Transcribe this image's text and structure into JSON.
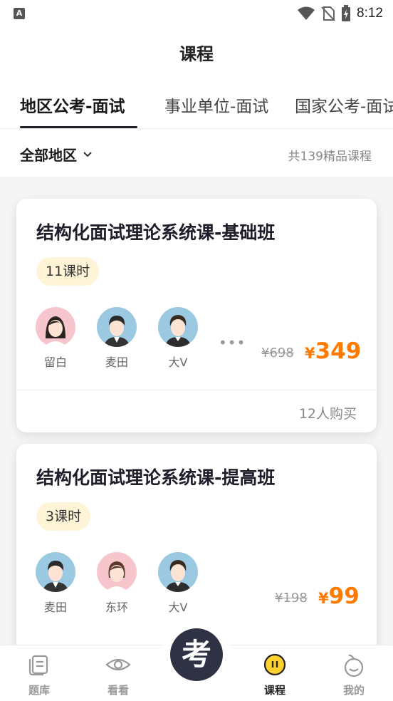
{
  "status": {
    "time": "8:12",
    "app_badge": "A"
  },
  "header": {
    "title": "课程"
  },
  "tabs": [
    {
      "label": "地区公考-面试"
    },
    {
      "label": "事业单位-面试"
    },
    {
      "label": "国家公考-面试"
    }
  ],
  "filter": {
    "region": "全部地区",
    "count": "共139精品课程"
  },
  "courses": [
    {
      "title": "结构化面试理论系统课-基础班",
      "lessons": "11课时",
      "teachers": [
        {
          "name": "留白",
          "avatar": "female-avatar"
        },
        {
          "name": "麦田",
          "avatar": "male-avatar"
        },
        {
          "name": "大V",
          "avatar": "male-avatar"
        }
      ],
      "more": "•••",
      "price_original": "¥698",
      "price_symbol": "¥",
      "price": "349",
      "buyers": "12人购买"
    },
    {
      "title": "结构化面试理论系统课-提高班",
      "lessons": "3课时",
      "teachers": [
        {
          "name": "麦田",
          "avatar": "male-avatar"
        },
        {
          "name": "东环",
          "avatar": "female-avatar"
        },
        {
          "name": "大V",
          "avatar": "male-avatar"
        }
      ],
      "price_original": "¥198",
      "price_symbol": "¥",
      "price": "99"
    }
  ],
  "bottom_nav": [
    {
      "label": "题库",
      "icon": "question-bank-icon"
    },
    {
      "label": "看看",
      "icon": "eye-icon"
    },
    {
      "label": "考",
      "icon": "exam-center-icon"
    },
    {
      "label": "课程",
      "icon": "course-icon"
    },
    {
      "label": "我的",
      "icon": "profile-icon"
    }
  ],
  "colors": {
    "accent": "#ff7a00",
    "badge_bg": "#fff5d6",
    "dark": "#2f3145"
  }
}
